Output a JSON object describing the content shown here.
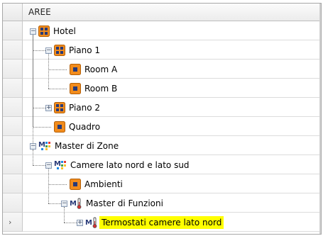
{
  "column_header": "AREE",
  "row_count": 11,
  "current_row_indicator": "›",
  "nodes": [
    {
      "label": "Hotel",
      "icon": "grid-icon",
      "expander": "−"
    },
    {
      "label": "Piano 1",
      "icon": "grid-icon",
      "expander": "−"
    },
    {
      "label": "Room A",
      "icon": "room-icon"
    },
    {
      "label": "Room B",
      "icon": "room-icon"
    },
    {
      "label": "Piano 2",
      "icon": "grid-icon",
      "expander": "+"
    },
    {
      "label": "Quadro",
      "icon": "room-icon"
    },
    {
      "label": "Master di Zone",
      "icon": "master-zone-icon",
      "expander": "−"
    },
    {
      "label": "Camere lato nord e lato sud",
      "icon": "master-zone-icon",
      "expander": "−"
    },
    {
      "label": "Ambienti",
      "icon": "room-icon"
    },
    {
      "label": "Master di Funzioni",
      "icon": "thermo-function-icon",
      "expander": "−"
    },
    {
      "label": "Termostati camere lato nord",
      "icon": "thermo-function-icon",
      "expander": "+",
      "selected": true
    }
  ],
  "colors": {
    "selection": "#ffff00",
    "node_orange": "#f28c1c",
    "node_navy": "#283a78"
  }
}
